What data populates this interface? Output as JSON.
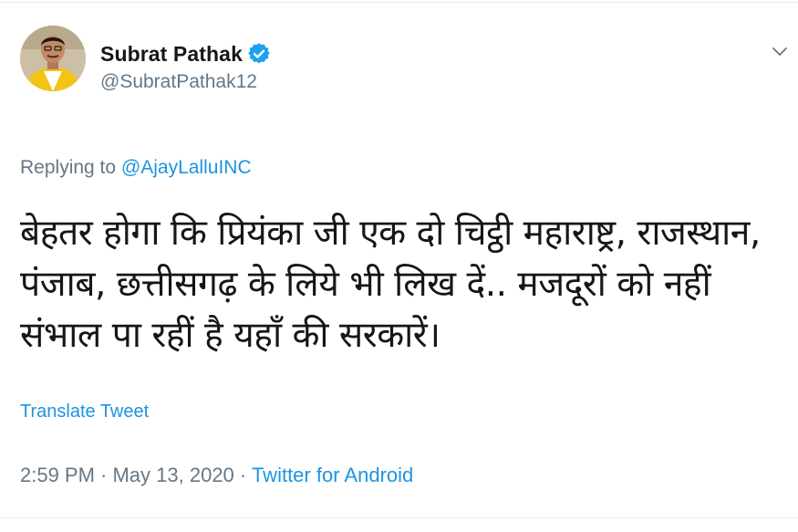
{
  "tweet": {
    "author": {
      "display_name": "Subrat Pathak",
      "handle": "@SubratPathak12",
      "verified": true
    },
    "reply": {
      "prefix": "Replying to ",
      "mention": "@AjayLalluINC"
    },
    "text": "बेहतर होगा कि प्रियंका जी एक दो चिट्ठी महाराष्ट्र, राजस्थान, पंजाब, छत्तीसगढ़ के लिये भी लिख दें.. मजदूरों को नहीं संभाल पा रहीं है यहाँ की सरकारें।",
    "translate_label": "Translate Tweet",
    "timestamp": "2:59 PM · May 13, 2020 · ",
    "source": "Twitter for Android"
  },
  "colors": {
    "link": "#1b95e0",
    "muted": "#657786",
    "text": "#14171a"
  },
  "icons": {
    "verified": "verified-badge-icon",
    "caret": "chevron-down-icon"
  }
}
